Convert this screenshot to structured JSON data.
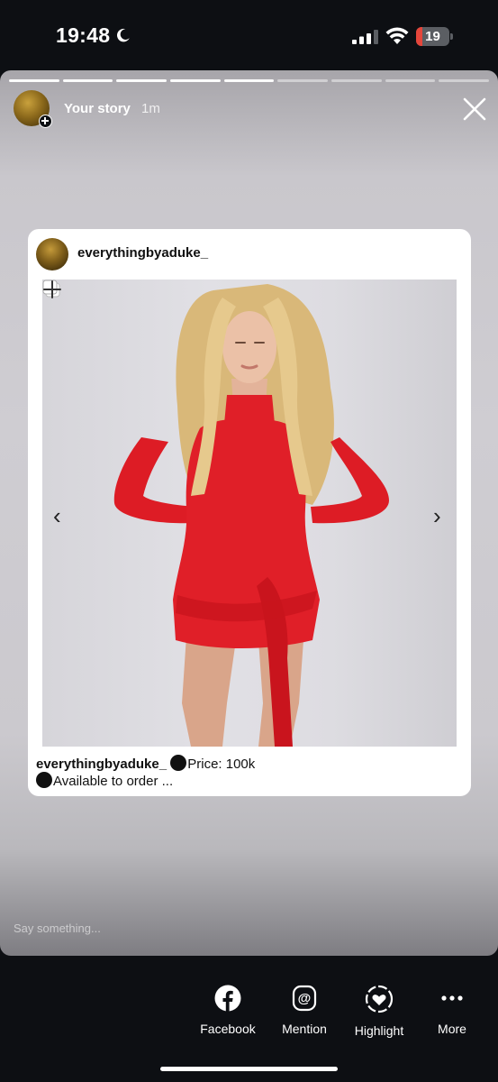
{
  "status_bar": {
    "time": "19:48",
    "battery_level": "19",
    "battery_percent": 19,
    "battery_color": "#e5463b"
  },
  "story": {
    "username": "Your story",
    "time_ago": "1m",
    "segments_total": 9,
    "segments_viewed": 5,
    "close_icon": "close-icon"
  },
  "post": {
    "username": "everythingbyaduke_",
    "caption_user": "everythingbyaduke_",
    "caption_line1": "Price: 100k",
    "caption_line2": "Available to order ...",
    "prev_glyph": "‹",
    "next_glyph": "›"
  },
  "reply": {
    "placeholder": "Say something..."
  },
  "actions": [
    {
      "label": "Facebook",
      "icon": "facebook-icon"
    },
    {
      "label": "Mention",
      "icon": "mention-icon"
    },
    {
      "label": "Highlight",
      "icon": "highlight-icon"
    },
    {
      "label": "More",
      "icon": "more-icon"
    }
  ]
}
